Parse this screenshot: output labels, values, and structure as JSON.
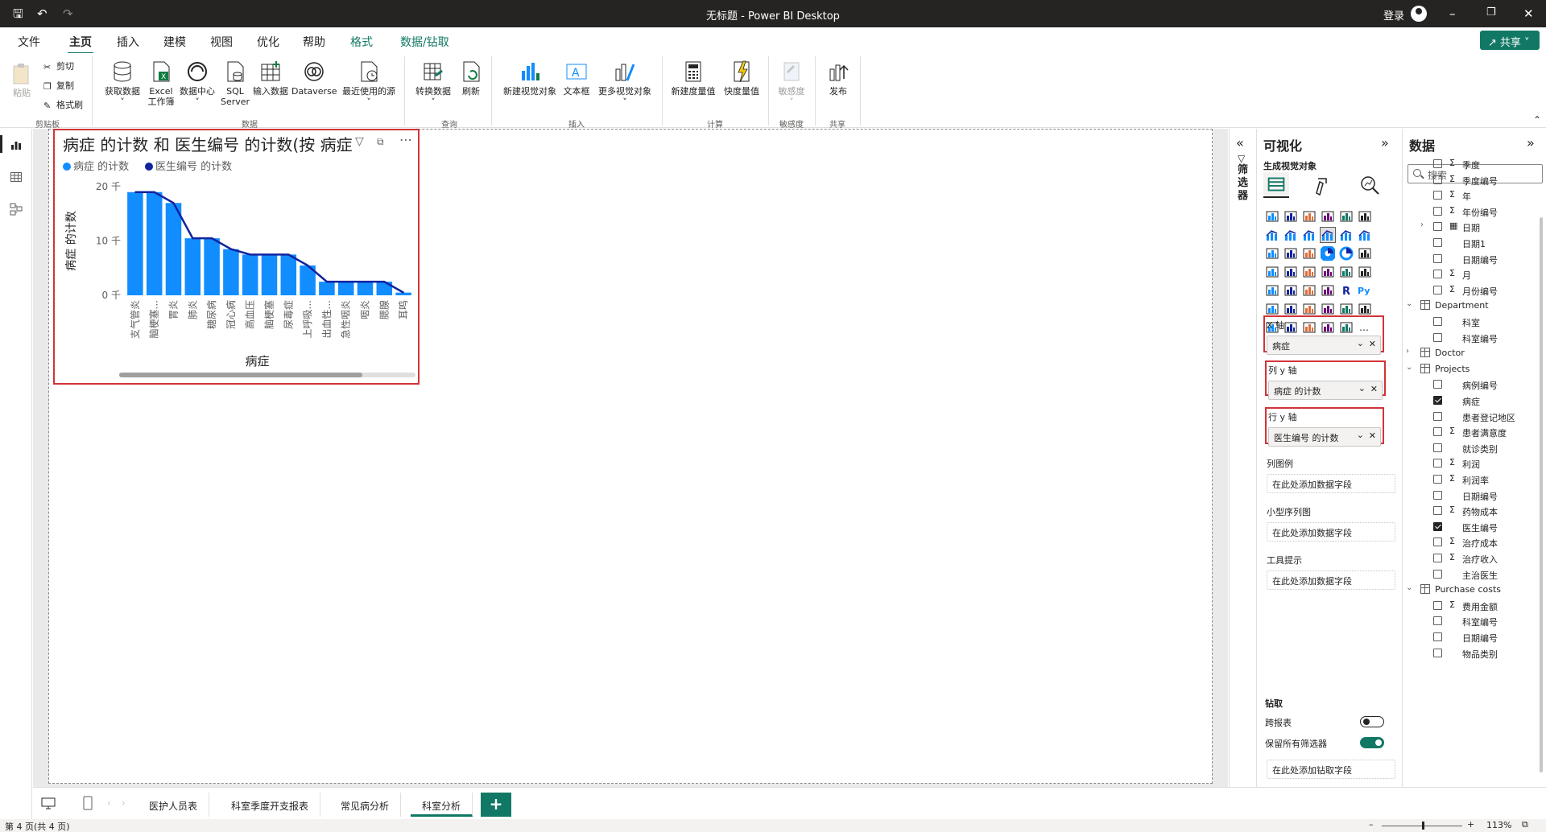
{
  "window": {
    "title": "无标题 - Power BI Desktop",
    "login": "登录"
  },
  "menu": {
    "tabs": [
      "文件",
      "主页",
      "插入",
      "建模",
      "视图",
      "优化",
      "帮助",
      "格式",
      "数据/钻取"
    ],
    "active": "主页",
    "share": "共享"
  },
  "ribbon": {
    "paste": "粘贴",
    "cut": "剪切",
    "copy": "复制",
    "format_painter": "格式刷",
    "get_data": "获取数据",
    "excel_1": "Excel",
    "excel_2": "工作簿",
    "data_hub": "数据中心",
    "sql_1": "SQL",
    "sql_2": "Server",
    "enter_data": "输入数据",
    "dataverse": "Dataverse",
    "recent_sources": "最近使用的源",
    "transform": "转换数据",
    "refresh": "刷新",
    "new_visual": "新建视觉对象",
    "text_box": "文本框",
    "more_visuals": "更多视觉对象",
    "new_measure": "新建度量值",
    "quick_measure": "快度量值",
    "sensitivity": "敏感度",
    "publish": "发布",
    "groups": {
      "clipboard": "剪贴板",
      "data": "数据",
      "queries": "查询",
      "insert": "插入",
      "calculations": "计算",
      "sensitivity": "敏感度",
      "share": "共享"
    }
  },
  "visual": {
    "title": "病症 的计数 和 医生编号 的计数(按 病症)",
    "legend": [
      {
        "label": "病症 的计数",
        "color": "#118DFF"
      },
      {
        "label": "医生编号 的计数",
        "color": "#12239E"
      }
    ]
  },
  "chart_data": {
    "type": "bar",
    "categories": [
      "支气管炎",
      "脑梗塞...",
      "胃炎",
      "肺炎",
      "糖尿病",
      "冠心病",
      "高血压",
      "脑梗塞",
      "尿毒症",
      "上呼吸...",
      "出血性...",
      "急性咽炎",
      "咽炎",
      "腮腺",
      "耳鸣"
    ],
    "series": [
      {
        "name": "病症 的计数",
        "type": "bar",
        "values": [
          19,
          19,
          17,
          10.5,
          10.5,
          8.5,
          7.5,
          7.5,
          7.5,
          5.5,
          2.5,
          2.5,
          2.5,
          2.5,
          0.5
        ]
      },
      {
        "name": "医生编号 的计数",
        "type": "line",
        "values": [
          19,
          19,
          17,
          10.5,
          10.5,
          8.5,
          7.5,
          7.5,
          7.5,
          5.5,
          2.5,
          2.5,
          2.5,
          2.5,
          0.5
        ]
      }
    ],
    "xlabel": "病症",
    "ylabel": "病症 的计数",
    "yticks": [
      "0 千",
      "10 千",
      "20 千"
    ],
    "ylim": [
      0,
      20
    ],
    "grid": false,
    "legend": "top-left"
  },
  "filters": {
    "label": "筛选器"
  },
  "viz_pane": {
    "title": "可视化",
    "subtitle": "生成视觉对象",
    "wells": {
      "x_axis": {
        "label": "X 轴",
        "value": "病症"
      },
      "col_y": {
        "label": "列 y 轴",
        "value": "病症 的计数"
      },
      "row_y": {
        "label": "行 y 轴",
        "value": "医生编号 的计数"
      },
      "col_legend": {
        "label": "列图例",
        "placeholder": "在此处添加数据字段"
      },
      "small_multiples": {
        "label": "小型序列图",
        "placeholder": "在此处添加数据字段"
      },
      "tooltips": {
        "label": "工具提示",
        "placeholder": "在此处添加数据字段"
      }
    },
    "drill": {
      "label": "钻取",
      "cross_report": "跨报表",
      "cross_report_on": false,
      "keep_filters": "保留所有筛选器",
      "keep_filters_on": true,
      "drill_placeholder": "在此处添加钻取字段"
    }
  },
  "data_pane": {
    "title": "数据",
    "search_placeholder": "搜索",
    "fields": [
      {
        "name": "季度",
        "sigma": true,
        "checked": false
      },
      {
        "name": "季度编号",
        "sigma": true,
        "checked": false
      },
      {
        "name": "年",
        "sigma": true,
        "checked": false
      },
      {
        "name": "年份编号",
        "sigma": true,
        "checked": false
      },
      {
        "name": "日期",
        "sigma": false,
        "checked": false,
        "expand": true,
        "hierarchy": true
      },
      {
        "name": "日期1",
        "sigma": false,
        "checked": false
      },
      {
        "name": "日期编号",
        "sigma": false,
        "checked": false
      },
      {
        "name": "月",
        "sigma": true,
        "checked": false
      },
      {
        "name": "月份编号",
        "sigma": true,
        "checked": false
      },
      {
        "table": "Department",
        "expanded": true
      },
      {
        "name": "科室",
        "sigma": false,
        "checked": false
      },
      {
        "name": "科室编号",
        "sigma": false,
        "checked": false
      },
      {
        "table": "Doctor",
        "expanded": false
      },
      {
        "table": "Projects",
        "expanded": true
      },
      {
        "name": "病例编号",
        "sigma": false,
        "checked": false
      },
      {
        "name": "病症",
        "sigma": false,
        "checked": true
      },
      {
        "name": "患者登记地区",
        "sigma": false,
        "checked": false
      },
      {
        "name": "患者满意度",
        "sigma": true,
        "checked": false
      },
      {
        "name": "就诊类别",
        "sigma": false,
        "checked": false
      },
      {
        "name": "利润",
        "sigma": true,
        "checked": false
      },
      {
        "name": "利润率",
        "sigma": true,
        "checked": false
      },
      {
        "name": "日期编号",
        "sigma": false,
        "checked": false
      },
      {
        "name": "药物成本",
        "sigma": true,
        "checked": false
      },
      {
        "name": "医生编号",
        "sigma": false,
        "checked": true
      },
      {
        "name": "治疗成本",
        "sigma": true,
        "checked": false
      },
      {
        "name": "治疗收入",
        "sigma": true,
        "checked": false
      },
      {
        "name": "主治医生",
        "sigma": false,
        "checked": false
      },
      {
        "table": "Purchase costs",
        "expanded": true
      },
      {
        "name": "费用金额",
        "sigma": true,
        "checked": false
      },
      {
        "name": "科室编号",
        "sigma": false,
        "checked": false
      },
      {
        "name": "日期编号",
        "sigma": false,
        "checked": false
      },
      {
        "name": "物品类别",
        "sigma": false,
        "checked": false
      }
    ]
  },
  "pages": {
    "tabs": [
      "医护人员表",
      "科室季度开支报表",
      "常见病分析",
      "科室分析"
    ],
    "active": "科室分析"
  },
  "status": {
    "page_info": "第 4 页(共 4 页)",
    "zoom": "113%",
    "zoom_level": 0.5
  }
}
